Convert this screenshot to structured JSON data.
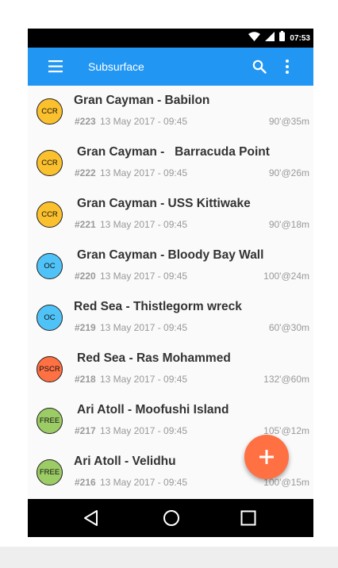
{
  "status_bar": {
    "time": "07:53",
    "icons": [
      "wifi-icon",
      "signal-icon",
      "battery-icon"
    ]
  },
  "app_bar": {
    "title": "Subsurface",
    "icons": [
      "menu-icon",
      "search-icon",
      "more-vert-icon"
    ]
  },
  "colors": {
    "app_bar": "#2196f3",
    "ccr": "#fbc02d",
    "oc": "#4fc3f7",
    "pscr": "#ff7043",
    "free": "#9ccc65",
    "fab": "#ff7043"
  },
  "dives": [
    {
      "type": "CCR",
      "title": "Gran Cayman - Babilon",
      "number": "#223",
      "date": "13 May 2017 - 09:45",
      "stats": "90'@35m"
    },
    {
      "type": "CCR",
      "title": "Gran Cayman -   Barracuda Point",
      "number": "#222",
      "date": "13 May 2017 - 09:45",
      "stats": "90'@26m"
    },
    {
      "type": "CCR",
      "title": "Gran Cayman - USS Kittiwake",
      "number": "#221",
      "date": "13 May 2017 - 09:45",
      "stats": "90'@18m"
    },
    {
      "type": "OC",
      "title": "Gran Cayman - Bloody Bay Wall",
      "number": "#220",
      "date": "13 May 2017 - 09:45",
      "stats": "100'@24m"
    },
    {
      "type": "OC",
      "title": "Red Sea - Thistlegorm wreck",
      "number": "#219",
      "date": "13 May 2017 - 09:45",
      "stats": "60'@30m"
    },
    {
      "type": "PSCR",
      "title": "Red Sea - Ras Mohammed",
      "number": "#218",
      "date": "13 May 2017 - 09:45",
      "stats": "132'@60m"
    },
    {
      "type": "FREE",
      "title": "Ari Atoll - Moofushi Island",
      "number": "#217",
      "date": "13 May 2017 - 09:45",
      "stats": "105'@12m"
    },
    {
      "type": "FREE",
      "title": "Ari Atoll - Velidhu",
      "number": "#216",
      "date": "13 May 2017 - 09:45",
      "stats": "100'@15m"
    }
  ],
  "fab": {
    "icon": "add-icon"
  },
  "nav_bar": {
    "icons": [
      "back-icon",
      "home-icon",
      "recents-icon"
    ]
  }
}
